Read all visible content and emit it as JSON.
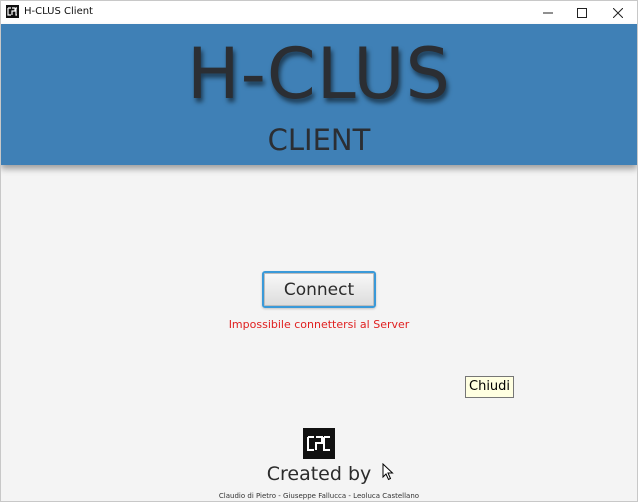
{
  "window": {
    "title": "H-CLUS Client",
    "app_icon": "app-logo-icon",
    "controls": {
      "minimize_icon": "minimize-icon",
      "maximize_icon": "maximize-icon",
      "close_icon": "close-icon"
    }
  },
  "banner": {
    "title": "H-CLUS",
    "subtitle": "CLIENT",
    "background_color": "#3f80b6"
  },
  "main": {
    "connect_label": "Connect",
    "error_message": "Impossibile connettersi al Server",
    "error_color": "#e02020"
  },
  "tooltip": {
    "text": "Chiudi"
  },
  "footer": {
    "logo_icon": "team-logo-icon",
    "created_by": "Created by",
    "authors": "Claudio di Pietro - Giuseppe Fallucca - Leoluca Castellano"
  }
}
